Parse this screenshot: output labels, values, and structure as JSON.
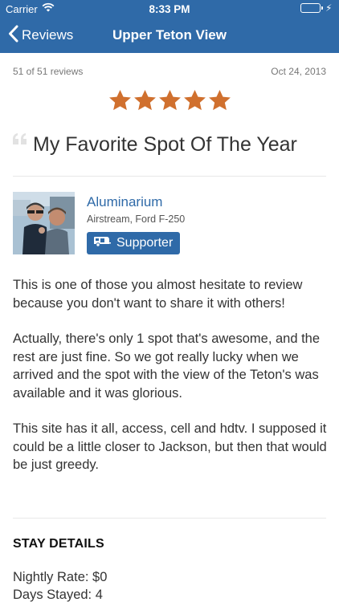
{
  "status_bar": {
    "carrier": "Carrier",
    "time": "8:33 PM",
    "battery_icon": "battery-charging-icon",
    "wifi_icon": "wifi-icon"
  },
  "nav": {
    "back_label": "Reviews",
    "title": "Upper Teton View",
    "back_icon": "chevron-left-icon"
  },
  "review": {
    "count_text": "51 of 51 reviews",
    "date": "Oct 24, 2013",
    "rating": 5,
    "rating_max": 5,
    "title": "My Favorite Spot Of The Year",
    "body": [
      "This is one of those you almost hesitate to review because you don't want to share it with others!",
      "Actually, there's only 1 spot that's awesome, and the rest are just fine.  So we got really lucky when we arrived and the spot with the view of the Teton's was available and it was glorious.",
      "This site has it all, access, cell and hdtv.  I supposed it could be a little closer to Jackson, but then that would be just greedy."
    ]
  },
  "author": {
    "name": "Aluminarium",
    "rig": "Airstream, Ford F-250",
    "badge_label": "Supporter",
    "badge_icon": "rv-trailer-icon"
  },
  "stay_details": {
    "heading": "STAY DETAILS",
    "nightly_rate": "Nightly Rate: $0",
    "days_stayed": "Days Stayed: 4"
  },
  "colors": {
    "nav_bg": "#2f6aa8",
    "star": "#d0702e",
    "link": "#2f6aa8",
    "battery": "#4cd964"
  }
}
